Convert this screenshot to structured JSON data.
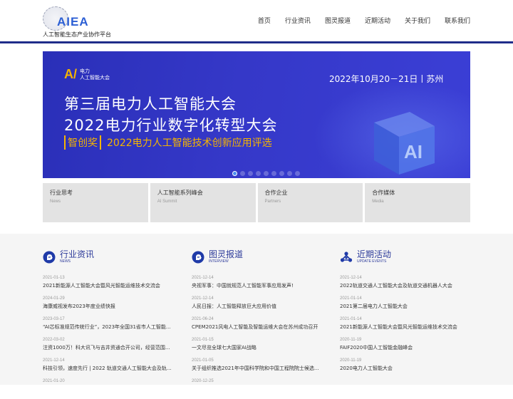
{
  "header": {
    "logo_text": "AIEA",
    "logo_sub": "人工智能生态产业协作平台",
    "nav": [
      "首页",
      "行业资讯",
      "图灵报道",
      "近期活动",
      "关于我们",
      "联系我们"
    ]
  },
  "banner": {
    "logo_mark": "A",
    "logo_line1": "电力",
    "logo_line2": "人工智能大会",
    "date": "2022年10月20－21日丨苏州",
    "title1": "第三届电力人工智能大会",
    "title2": "2022电力行业数字化转型大会",
    "award_tag": "智创奖",
    "award_text": "2022电力人工智能技术创新应用评选",
    "cube_text": "AI"
  },
  "cards": [
    {
      "title": "行业思考",
      "sub": "News"
    },
    {
      "title": "人工智能系列峰会",
      "sub": "AI Summit"
    },
    {
      "title": "合作企业",
      "sub": "Partners"
    },
    {
      "title": "合作媒体",
      "sub": "Media"
    }
  ],
  "columns": [
    {
      "title": "行业资讯",
      "en": "NEWS",
      "icon": "ai-head-icon",
      "items": [
        {
          "date": "2021-01-13",
          "title": "2021新能源人工智能大会暨风光智能运维技术交流会"
        },
        {
          "date": "2024-01-29",
          "title": "海康威视发布2023年度业绩快报"
        },
        {
          "date": "2023-03-17",
          "title": "“AI芯标准规范传统行业”，2023年全国31省市人工智能..."
        },
        {
          "date": "2022-03-02",
          "title": "注资1000万！科大讯飞与吉井资通合开公司，经营范围..."
        },
        {
          "date": "2021-12-14",
          "title": "科技引领，速度先行 | 2022 轨道交通人工智能大会及轨..."
        },
        {
          "date": "2021-01-20",
          "title": ""
        }
      ]
    },
    {
      "title": "图灵报道",
      "en": "INTERVIEW",
      "icon": "ai-head-icon",
      "items": [
        {
          "date": "2021-12-14",
          "title": "央视军事：中国就规范人工智能军事应用发声!"
        },
        {
          "date": "2021-12-14",
          "title": "人民日报：人工智能释放巨大应用价值"
        },
        {
          "date": "2021-06-24",
          "title": "CPEM2021风电人工智能及智能运维大会在苏州成功召开"
        },
        {
          "date": "2021-01-15",
          "title": "一文尽览全球七大国家AI战略"
        },
        {
          "date": "2021-01-05",
          "title": "关于组织推选2021年中国科学院和中国工程院院士候选..."
        },
        {
          "date": "2020-12-25",
          "title": ""
        }
      ]
    },
    {
      "title": "近期活动",
      "en": "UPDATE EVENTS",
      "icon": "network-icon",
      "items": [
        {
          "date": "2021-12-14",
          "title": "2022轨道交通人工智能大会及轨道交通机器人大会"
        },
        {
          "date": "2021-01-14",
          "title": "2021第二届电力人工智能大会"
        },
        {
          "date": "2021-01-14",
          "title": "2021新能源人工智能大会暨风光智能运维技术交流会"
        },
        {
          "date": "2020-11-19",
          "title": "FAIF2020中国人工智能金融峰会"
        },
        {
          "date": "2020-11-19",
          "title": "2020电力人工智能大会"
        }
      ]
    }
  ]
}
